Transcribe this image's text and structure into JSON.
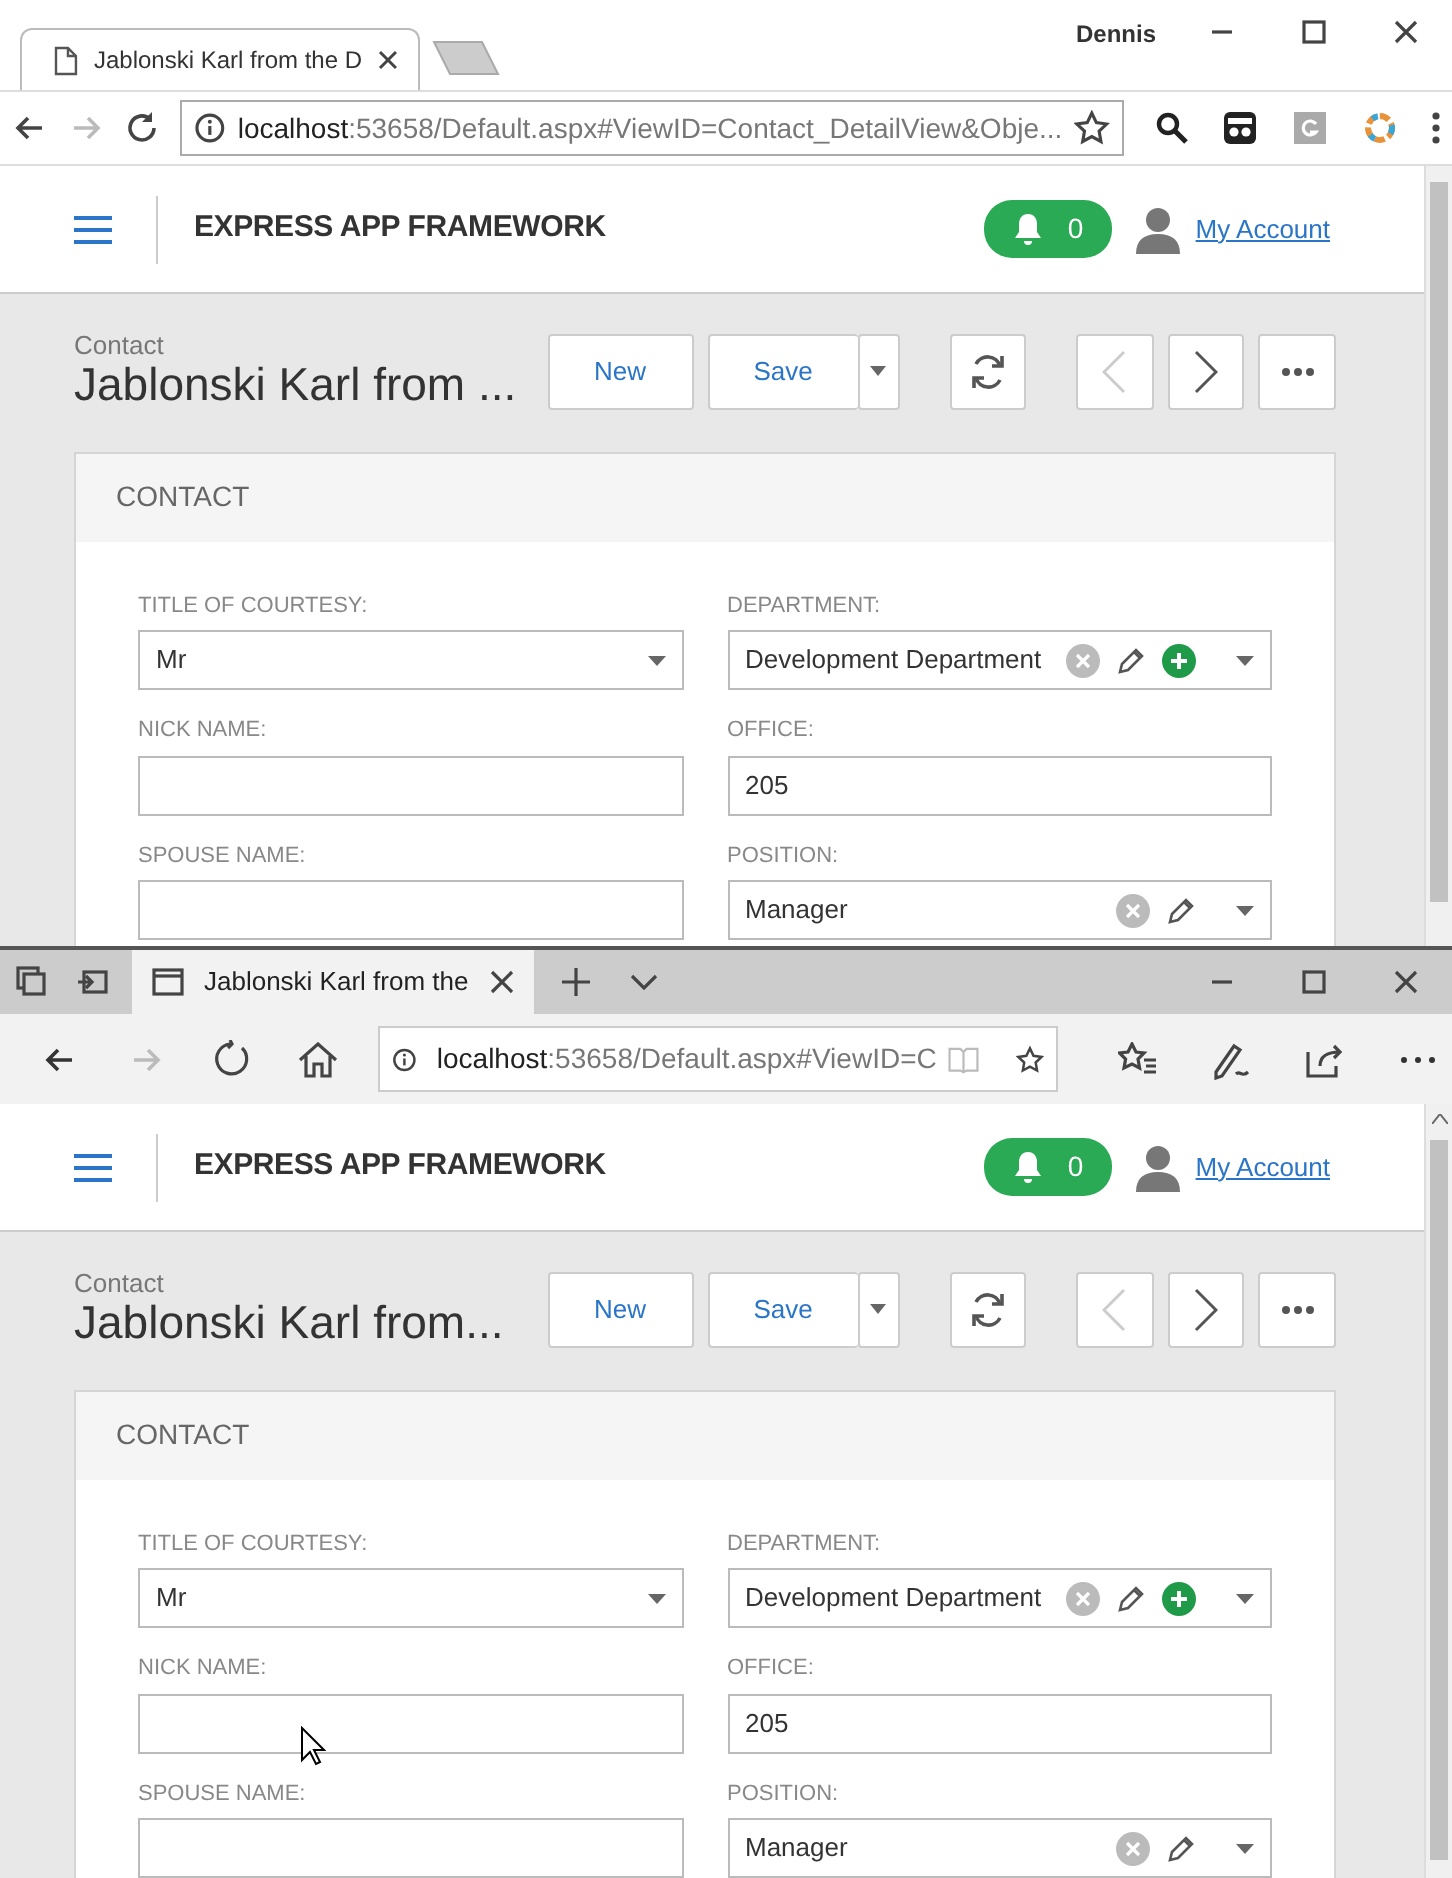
{
  "windows": [
    {
      "kind": "chrome",
      "profile": "Dennis",
      "tab": {
        "title": "Jablonski Karl from the D"
      },
      "address": {
        "host": "localhost",
        "path": ":53658/Default.aspx#ViewID=Contact_DetailView&Obje..."
      },
      "forward_enabled": false,
      "app": {
        "brand": "EXPRESS APP FRAMEWORK",
        "notifications": "0",
        "account": "My Account",
        "breadcrumb": "Contact",
        "title": "Jablonski Karl from ...",
        "actions": [
          {
            "label": "New",
            "dropdown": false
          },
          {
            "label": "Save",
            "dropdown": true
          }
        ],
        "prev_enabled": false,
        "next_enabled": true,
        "section": "CONTACT",
        "fields": [
          {
            "label": "TITLE OF COURTESY:",
            "kind": "dropdown",
            "value": "Mr"
          },
          {
            "label": "DEPARTMENT:",
            "kind": "lookup",
            "value": "Development Department",
            "add": true
          },
          {
            "label": "NICK NAME:",
            "kind": "text"
          },
          {
            "label": "OFFICE:",
            "kind": "text",
            "value": "205"
          },
          {
            "label": "SPOUSE NAME:",
            "kind": "text"
          },
          {
            "label": "POSITION:",
            "kind": "lookup",
            "value": "Manager",
            "add": false
          }
        ]
      }
    },
    {
      "kind": "edge",
      "tab": {
        "title": "Jablonski Karl from the"
      },
      "address": {
        "host": "localhost",
        "path": ":53658/Default.aspx#ViewID=C"
      },
      "forward_enabled": false,
      "app": {
        "brand": "EXPRESS APP FRAMEWORK",
        "notifications": "0",
        "account": "My Account",
        "breadcrumb": "Contact",
        "title": "Jablonski Karl from...",
        "actions": [
          {
            "label": "New",
            "dropdown": false
          },
          {
            "label": "Save",
            "dropdown": true
          }
        ],
        "prev_enabled": false,
        "next_enabled": true,
        "section": "CONTACT",
        "fields": [
          {
            "label": "TITLE OF COURTESY:",
            "kind": "dropdown",
            "value": "Mr"
          },
          {
            "label": "DEPARTMENT:",
            "kind": "lookup",
            "value": "Development Department",
            "add": true
          },
          {
            "label": "NICK NAME:",
            "kind": "text"
          },
          {
            "label": "OFFICE:",
            "kind": "text",
            "value": "205"
          },
          {
            "label": "SPOUSE NAME:",
            "kind": "text"
          },
          {
            "label": "POSITION:",
            "kind": "lookup",
            "value": "Manager",
            "add": false
          }
        ]
      }
    }
  ]
}
